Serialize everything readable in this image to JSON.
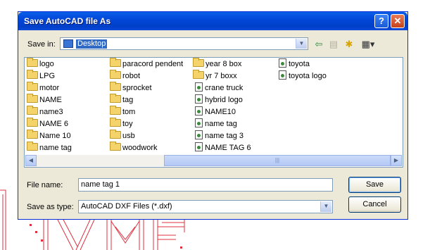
{
  "dialog": {
    "title": "Save AutoCAD file  As",
    "help_label": "?",
    "close_label": "✕"
  },
  "save_in": {
    "label": "Save in:",
    "value": "Desktop"
  },
  "toolbar": {
    "back_icon": "back-arrow-icon",
    "up_icon": "up-folder-icon",
    "new_folder_icon": "new-folder-icon",
    "views_icon": "views-menu-icon"
  },
  "files": {
    "col1": [
      {
        "name": "logo",
        "type": "folder"
      },
      {
        "name": "LPG",
        "type": "folder"
      },
      {
        "name": "motor",
        "type": "folder"
      },
      {
        "name": "NAME",
        "type": "folder"
      },
      {
        "name": "name3",
        "type": "folder"
      },
      {
        "name": "NAME 6",
        "type": "folder"
      },
      {
        "name": "Name 10",
        "type": "folder"
      },
      {
        "name": "name tag",
        "type": "folder"
      }
    ],
    "col2": [
      {
        "name": "paracord pendent",
        "type": "folder"
      },
      {
        "name": "robot",
        "type": "folder"
      },
      {
        "name": "sprocket",
        "type": "folder"
      },
      {
        "name": "tag",
        "type": "folder"
      },
      {
        "name": "tom",
        "type": "folder"
      },
      {
        "name": "toy",
        "type": "folder"
      },
      {
        "name": "usb",
        "type": "folder"
      },
      {
        "name": "woodwork",
        "type": "folder"
      }
    ],
    "col3": [
      {
        "name": "year 8 box",
        "type": "folder"
      },
      {
        "name": "yr 7 boxx",
        "type": "folder"
      },
      {
        "name": "crane truck",
        "type": "dxf"
      },
      {
        "name": "hybrid logo",
        "type": "dxf"
      },
      {
        "name": "NAME10",
        "type": "dxf"
      },
      {
        "name": "name tag",
        "type": "dxf"
      },
      {
        "name": "name tag 3",
        "type": "dxf"
      },
      {
        "name": "NAME TAG 6",
        "type": "dxf"
      }
    ],
    "col4": [
      {
        "name": "toyota",
        "type": "dxf"
      },
      {
        "name": "toyota logo",
        "type": "dxf"
      }
    ]
  },
  "file_name": {
    "label": "File name:",
    "value": "name tag 1"
  },
  "save_as_type": {
    "label": "Save as type:",
    "value": "AutoCAD DXF Files (*.dxf)"
  },
  "buttons": {
    "save": "Save",
    "cancel": "Cancel"
  },
  "colors": {
    "titlebar": "#0245d7",
    "selection": "#316ac5",
    "background_drawing": "#e03040"
  }
}
